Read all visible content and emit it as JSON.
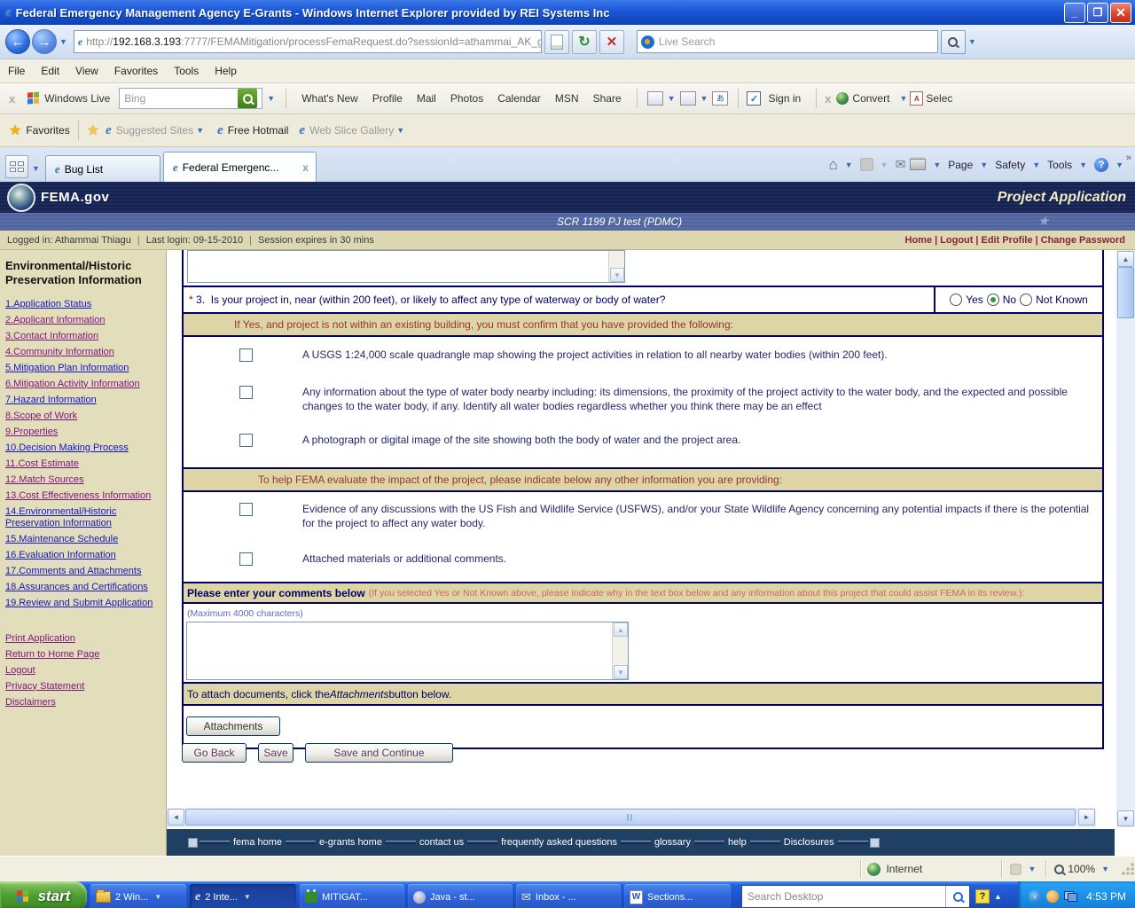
{
  "icons": {
    "ie_logo": "e",
    "back_arrow": "←",
    "forward_arrow": "→",
    "dropdown": "▼",
    "refresh": "↻",
    "stop": "×",
    "close": "×",
    "minimize": "_",
    "restore": "❐",
    "home": "⌂",
    "mail": "✉",
    "star": "★",
    "add_star": "★",
    "left_arrow": "◄",
    "right_arrow": "►",
    "up_arrow": "▲",
    "down_arrow": "▼",
    "chevrons": "»",
    "help_mark": "?",
    "tray_back": "‹",
    "word_w": "W",
    "check": "✓",
    "pdf": "A"
  },
  "window": {
    "title": "Federal Emergency Management Agency E-Grants - Windows Internet Explorer provided by REI Systems Inc",
    "url_scheme": "http://",
    "url_host": "192.168.3.193",
    "url_rest": ":7777/FEMAMitigation/processFemaRequest.do?sessionId=athammai_AK_g",
    "live_search_placeholder": "Live Search"
  },
  "menu": {
    "items": [
      {
        "label": "File"
      },
      {
        "label": "Edit"
      },
      {
        "label": "View"
      },
      {
        "label": "Favorites"
      },
      {
        "label": "Tools"
      },
      {
        "label": "Help"
      }
    ]
  },
  "live_toolbar": {
    "brand": "Windows Live",
    "bing_placeholder": "Bing",
    "links": [
      {
        "label": "What's New"
      },
      {
        "label": "Profile"
      },
      {
        "label": "Mail"
      },
      {
        "label": "Photos"
      },
      {
        "label": "Calendar"
      },
      {
        "label": "MSN"
      },
      {
        "label": "Share"
      }
    ],
    "sign_in": "Sign in",
    "convert": "Convert",
    "select": "Selec"
  },
  "favorites_bar": {
    "favorites_label": "Favorites",
    "suggested_sites": "Suggested Sites",
    "free_hotmail": "Free Hotmail",
    "web_slice_gallery": "Web Slice Gallery"
  },
  "tabs": [
    {
      "label": "Bug List",
      "active": false
    },
    {
      "label": "Federal Emergenc...",
      "active": true
    }
  ],
  "command_bar": {
    "page": "Page",
    "safety": "Safety",
    "tools": "Tools"
  },
  "site_header": {
    "brand": "FEMA.gov",
    "page_title": "Project Application",
    "subtitle": "SCR 1199 PJ test (PDMC)",
    "logged_in": "Logged in: Athammai Thiagu",
    "last_login": "Last login: 09-15-2010",
    "session": "Session expires in 30 mins",
    "nav": [
      {
        "label": "Home"
      },
      {
        "label": "Logout"
      },
      {
        "label": "Edit Profile"
      },
      {
        "label": "Change Password"
      }
    ]
  },
  "sidebar": {
    "title": "Environmental/Historic Preservation Information",
    "items": [
      {
        "label": "1.Application Status",
        "visited": false
      },
      {
        "label": "2.Applicant Information",
        "visited": true
      },
      {
        "label": "3.Contact Information",
        "visited": true
      },
      {
        "label": "4.Community Information",
        "visited": true
      },
      {
        "label": "5.Mitigation Plan Information",
        "visited": false
      },
      {
        "label": "6.Mitigation Activity Information",
        "visited": true
      },
      {
        "label": "7.Hazard Information",
        "visited": false
      },
      {
        "label": "8.Scope of Work",
        "visited": true
      },
      {
        "label": "9.Properties",
        "visited": true
      },
      {
        "label": "10.Decision Making Process",
        "visited": false
      },
      {
        "label": "11.Cost Estimate",
        "visited": true
      },
      {
        "label": "12.Match Sources",
        "visited": true
      },
      {
        "label": "13.Cost Effectiveness Information",
        "visited": true
      },
      {
        "label": "14.Environmental/Historic Preservation Information",
        "visited": false
      },
      {
        "label": "15.Maintenance Schedule",
        "visited": false
      },
      {
        "label": "16.Evaluation Information",
        "visited": false
      },
      {
        "label": "17.Comments and Attachments",
        "visited": false
      },
      {
        "label": "18.Assurances and Certifications",
        "visited": false
      },
      {
        "label": "19.Review and Submit Application",
        "visited": false
      }
    ],
    "utility_links": [
      {
        "label": "Print Application",
        "visited": true
      },
      {
        "label": "Return to Home Page",
        "visited": true
      },
      {
        "label": "Logout",
        "visited": true
      },
      {
        "label": "Privacy Statement",
        "visited": true
      },
      {
        "label": "Disclaimers",
        "visited": true
      }
    ]
  },
  "form": {
    "q3": {
      "asterisk": "*",
      "number": "3.",
      "text": "Is your project in, near (within 200 feet), or likely to affect any type of waterway or body of water?",
      "options": [
        {
          "label": "Yes",
          "selected": false
        },
        {
          "label": "No",
          "selected": true
        },
        {
          "label": "Not Known",
          "selected": false
        }
      ]
    },
    "if_yes_band": "If Yes, and project is not within an existing building, you must confirm that you have provided the following:",
    "checklist1": [
      {
        "label": "A USGS 1:24,000 scale quadrangle map showing the project activities in relation to all nearby water bodies (within 200 feet).",
        "checked": false
      },
      {
        "label": "Any information about the type of water body nearby including: its dimensions, the proximity of the project activity to the water body, and the expected and possible changes to the water body, if any. Identify all water bodies regardless whether you think there may be an effect",
        "checked": false
      },
      {
        "label": "A photograph or digital image of the site showing both the body of water and the project area.",
        "checked": false
      }
    ],
    "evaluate_band": "To help FEMA evaluate the impact of the project, please indicate below any other information you are providing:",
    "checklist2": [
      {
        "label": "Evidence of any discussions with the US Fish and Wildlife Service (USFWS), and/or your State Wildlife Agency concerning any potential impacts if there is the potential for the project to affect any water body.",
        "checked": false
      },
      {
        "label": "Attached materials or additional comments.",
        "checked": false
      }
    ],
    "comments_label": "Please enter your comments below",
    "comments_note": "(If you selected Yes or Not Known above, please indicate why in the text box below and any information about this project that could assist FEMA in its review.):",
    "max_chars": "(Maximum 4000 characters)",
    "comments_value": "",
    "attach_pre": "To attach documents, click the ",
    "attach_italic": "Attachments",
    "attach_post": " button below.",
    "attachments_button": "Attachments",
    "go_back_button": "Go Back",
    "save_button": "Save",
    "save_continue_button": "Save and Continue"
  },
  "site_footer": {
    "links": [
      {
        "label": "fema home"
      },
      {
        "label": "e-grants home"
      },
      {
        "label": "contact us"
      },
      {
        "label": "frequently asked questions"
      },
      {
        "label": "glossary"
      },
      {
        "label": "help"
      },
      {
        "label": "Disclosures"
      }
    ]
  },
  "status_bar": {
    "zone": "Internet",
    "zoom": "100%"
  },
  "taskbar": {
    "start": "start",
    "items": [
      {
        "label": "2 Win...",
        "grouped": true,
        "active": false
      },
      {
        "label": "2 Inte...",
        "grouped": true,
        "active": true
      },
      {
        "label": "MITIGAT...",
        "grouped": false,
        "active": false
      },
      {
        "label": "Java - st...",
        "grouped": false,
        "active": false
      },
      {
        "label": "Inbox - ...",
        "grouped": false,
        "active": false
      },
      {
        "label": "Sections...",
        "grouped": false,
        "active": false
      }
    ],
    "search_placeholder": "Search Desktop",
    "time": "4:53 PM"
  }
}
